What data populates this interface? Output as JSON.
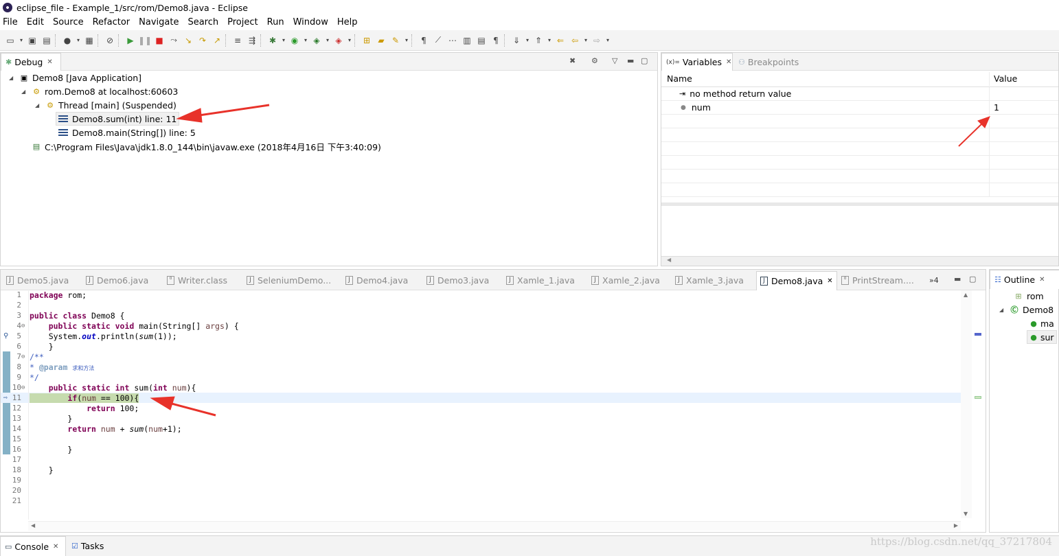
{
  "window": {
    "title": "eclipse_file - Example_1/src/rom/Demo8.java - Eclipse"
  },
  "menu": [
    "File",
    "Edit",
    "Source",
    "Refactor",
    "Navigate",
    "Search",
    "Project",
    "Run",
    "Window",
    "Help"
  ],
  "debug": {
    "tab": "Debug",
    "tree": [
      {
        "label": "Demo8 [Java Application]"
      },
      {
        "label": "rom.Demo8 at localhost:60603"
      },
      {
        "label": "Thread [main] (Suspended)"
      },
      {
        "label": "Demo8.sum(int) line: 11"
      },
      {
        "label": "Demo8.main(String[]) line: 5"
      },
      {
        "label": "C:\\Program Files\\Java\\jdk1.8.0_144\\bin\\javaw.exe (2018年4月16日 下午3:40:09)"
      }
    ]
  },
  "variables": {
    "tab": "Variables",
    "tab_prefix": "(x)=",
    "breakpoints_tab": "Breakpoints",
    "col_name": "Name",
    "col_value": "Value",
    "rows": [
      {
        "name": "no method return value",
        "value": ""
      },
      {
        "name": "num",
        "value": "1"
      }
    ]
  },
  "editor": {
    "tabs": [
      "Demo5.java",
      "Demo6.java",
      "Writer.class",
      "SeleniumDemo...",
      "Demo4.java",
      "Demo3.java",
      "Xamle_1.java",
      "Xamle_2.java",
      "Xamle_3.java",
      "Demo8.java",
      "PrintStream...."
    ],
    "overflow": "»4",
    "line_numbers": [
      "1",
      "2",
      "3",
      "4",
      "5",
      "6",
      "7",
      "8",
      "9",
      "10",
      "11",
      "12",
      "13",
      "14",
      "15",
      "16",
      "17",
      "18",
      "19",
      "20",
      "21"
    ]
  },
  "outline": {
    "tab": "Outline",
    "items": [
      "rom",
      "Demo8",
      "ma",
      "sur"
    ]
  },
  "bottom": {
    "console": "Console",
    "tasks": "Tasks",
    "watermark": "https://blog.csdn.net/qq_37217804"
  }
}
